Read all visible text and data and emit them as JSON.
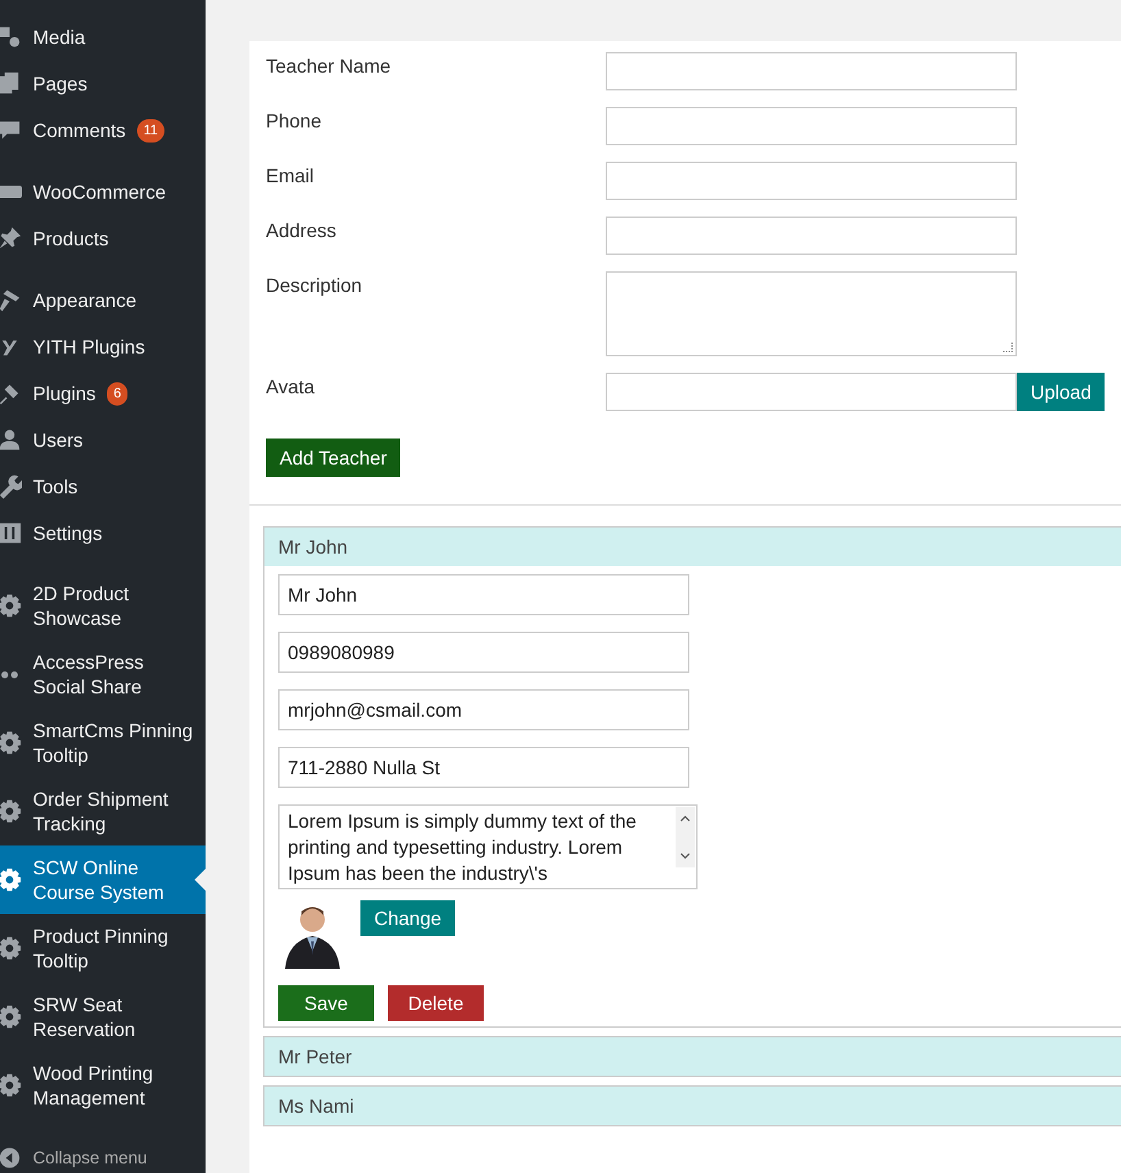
{
  "sidebar": {
    "groups": [
      [
        {
          "label": "Media",
          "selected": false
        },
        {
          "label": "Pages",
          "selected": false
        },
        {
          "label": "Comments",
          "badge": "11",
          "selected": false
        }
      ],
      [
        {
          "label": "WooCommerce",
          "selected": false
        },
        {
          "label": "Products",
          "selected": false
        }
      ],
      [
        {
          "label": "Appearance",
          "selected": false
        },
        {
          "label": "YITH Plugins",
          "selected": false
        },
        {
          "label": "Plugins",
          "badge": "6",
          "selected": false
        },
        {
          "label": "Users",
          "selected": false
        },
        {
          "label": "Tools",
          "selected": false
        },
        {
          "label": "Settings",
          "selected": false
        }
      ],
      [
        {
          "label": "2D Product Showcase",
          "selected": false
        },
        {
          "label": "AccessPress Social Share",
          "selected": false
        },
        {
          "label": "SmartCms Pinning Tooltip",
          "selected": false
        },
        {
          "label": "Order Shipment Tracking",
          "selected": false
        },
        {
          "label": "SCW Online Course System",
          "selected": true
        },
        {
          "label": "Product Pinning Tooltip",
          "selected": false
        },
        {
          "label": "SRW Seat Reservation",
          "selected": false
        },
        {
          "label": "Wood Printing Management",
          "selected": false
        }
      ]
    ],
    "collapse": "Collapse menu"
  },
  "form": {
    "fields": [
      {
        "label": "Teacher Name",
        "kind": "text"
      },
      {
        "label": "Phone",
        "kind": "text"
      },
      {
        "label": "Email",
        "kind": "text"
      },
      {
        "label": "Address",
        "kind": "text"
      },
      {
        "label": "Description",
        "kind": "textarea"
      },
      {
        "label": "Avata",
        "kind": "upload",
        "button": "Upload"
      }
    ],
    "submit": "Add Teacher"
  },
  "teachers": [
    {
      "name": "Mr John",
      "expanded": true,
      "name_value": "Mr John",
      "phone": "0989080989",
      "email": "mrjohn@csmail.com",
      "address": "711-2880 Nulla St",
      "description": "Lorem Ipsum is simply dummy text of the printing and typesetting industry. Lorem Ipsum has been the industry\\'s",
      "change": "Change",
      "save": "Save",
      "delete": "Delete"
    },
    {
      "name": "Mr Peter",
      "expanded": false
    },
    {
      "name": "Ms Nami",
      "expanded": false
    }
  ]
}
